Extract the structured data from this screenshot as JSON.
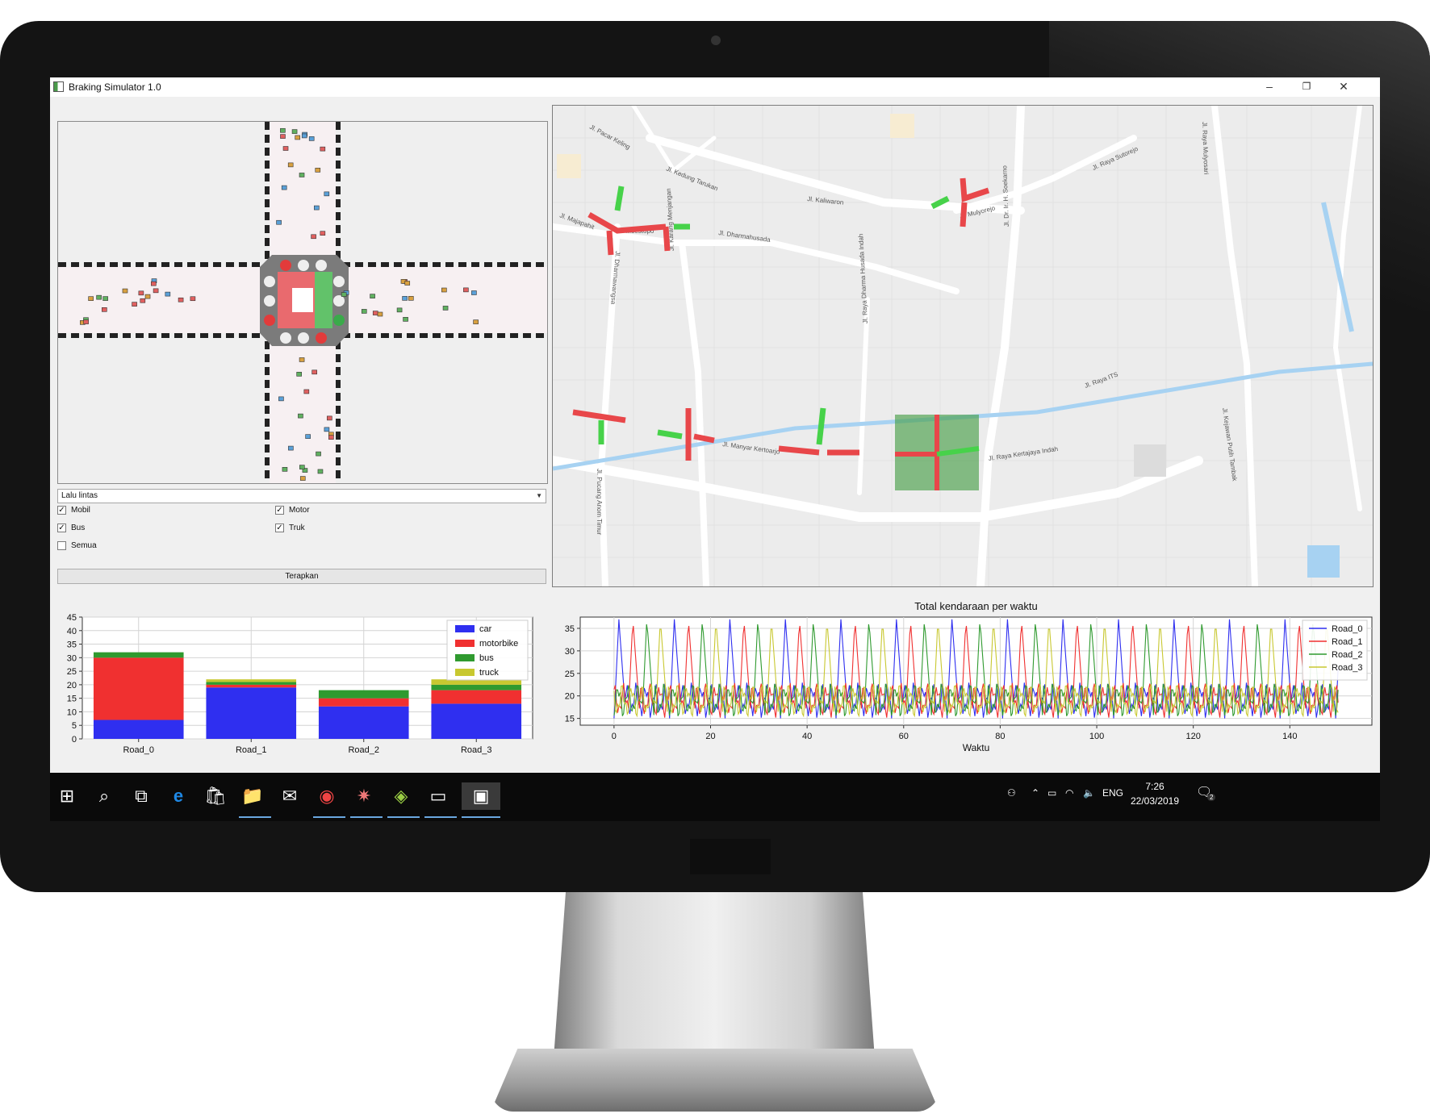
{
  "window": {
    "title": "Braking Simulator 1.0",
    "controls": {
      "minimize": "–",
      "maximize": "❐",
      "close": "✕"
    }
  },
  "controls": {
    "view_select": "Lalu lintas",
    "checkboxes": [
      {
        "label": "Mobil",
        "checked": true
      },
      {
        "label": "Motor",
        "checked": true
      },
      {
        "label": "Bus",
        "checked": true
      },
      {
        "label": "Truk",
        "checked": true
      },
      {
        "label": "Semua",
        "checked": false
      }
    ],
    "apply_label": "Terapkan"
  },
  "map": {
    "streets": [
      "Jl. Pacar Keling",
      "Jl. Kedung Tarukan",
      "Jl. Kaliwaron",
      "Jl. Raya Sutorejo",
      "Jl. Raya Mulyosari",
      "Jl. Majapahit",
      "Jl. Moestopo",
      "Jl. Dharmahusada",
      "Jl. Mulyorejo",
      "Jl. Dr. Ir. H. Soekarno",
      "Jl. Dharmawangsa",
      "Jl. Karang Menjangan",
      "Jl. Raya Dharma Husada Indah",
      "Jl. Raya ITS",
      "Jl. Manyar Kertoarjo",
      "Jl. Raya Kertajaya Indah",
      "Jl. Kejawan Putih Tambak",
      "Jl. Pucang Anom Timur"
    ]
  },
  "colors": {
    "car": "#2f2ff0",
    "motorbike": "#f03030",
    "bus": "#2f9a2f",
    "truck": "#c8c830",
    "road_0": "#2f2ff0",
    "road_1": "#f03030",
    "road_2": "#2f9a2f",
    "road_3": "#c8c830",
    "congested": "#e8474a",
    "free": "#47d24a"
  },
  "chart_data": [
    {
      "type": "bar",
      "stacked": true,
      "categories": [
        "Road_0",
        "Road_1",
        "Road_2",
        "Road_3"
      ],
      "series": [
        {
          "name": "car",
          "values": [
            7,
            19,
            12,
            13
          ]
        },
        {
          "name": "motorbike",
          "values": [
            23,
            1,
            3,
            5
          ]
        },
        {
          "name": "bus",
          "values": [
            2,
            1,
            3,
            2
          ]
        },
        {
          "name": "truck",
          "values": [
            0,
            1,
            0,
            2
          ]
        }
      ],
      "ylim": [
        0,
        45
      ],
      "yticks": [
        0,
        5,
        10,
        15,
        20,
        25,
        30,
        35,
        40,
        45
      ],
      "grid": true,
      "legend": "top-right"
    },
    {
      "type": "line",
      "title": "Total kendaraan per waktu",
      "xlabel": "Waktu",
      "ylabel": "",
      "xlim": [
        -7,
        157
      ],
      "ylim": [
        13.5,
        37.5
      ],
      "xticks": [
        0,
        20,
        40,
        60,
        80,
        100,
        120,
        140
      ],
      "yticks": [
        15,
        20,
        25,
        30,
        35
      ],
      "grid": true,
      "legend": "top-right",
      "period": 11.5,
      "series": [
        {
          "name": "Road_0",
          "x_start": 0,
          "x_end": 150,
          "phase": 0,
          "min": 15,
          "max": 37
        },
        {
          "name": "Road_1",
          "x_start": 0,
          "x_end": 150,
          "phase": 2.9,
          "min": 15,
          "max": 37
        },
        {
          "name": "Road_2",
          "x_start": 0,
          "x_end": 150,
          "phase": 5.8,
          "min": 15,
          "max": 37
        },
        {
          "name": "Road_3",
          "x_start": 0,
          "x_end": 150,
          "phase": 8.6,
          "min": 15,
          "max": 37
        }
      ]
    }
  ],
  "taskbar": {
    "apps": [
      {
        "name": "start",
        "glyph": "⊞"
      },
      {
        "name": "search",
        "glyph": "⌕"
      },
      {
        "name": "task-view",
        "glyph": "⧉"
      },
      {
        "name": "edge",
        "glyph": "e"
      },
      {
        "name": "store",
        "glyph": "🛍"
      },
      {
        "name": "file-explorer",
        "glyph": "📁"
      },
      {
        "name": "mail",
        "glyph": "✉"
      },
      {
        "name": "chrome",
        "glyph": "◉"
      },
      {
        "name": "network-app",
        "glyph": "✷"
      },
      {
        "name": "bluestacks",
        "glyph": "◈"
      },
      {
        "name": "terminal",
        "glyph": "▭"
      },
      {
        "name": "simulator",
        "glyph": "▣"
      }
    ],
    "tray": {
      "language": "ENG",
      "time": "7:26",
      "date": "22/03/2019",
      "notifications": "2"
    }
  }
}
